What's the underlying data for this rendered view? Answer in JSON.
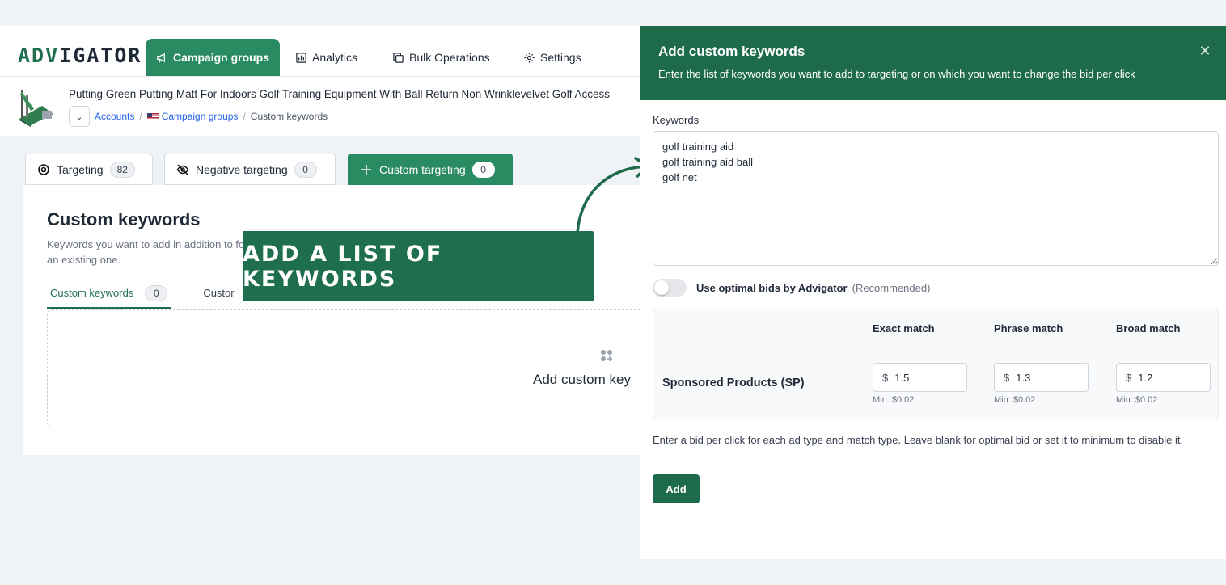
{
  "app": {
    "logo_prefix": "ADV",
    "logo_suffix": "IGATOR"
  },
  "nav": {
    "campaign_groups": "Campaign groups",
    "analytics": "Analytics",
    "bulk_operations": "Bulk Operations",
    "settings": "Settings"
  },
  "product": {
    "title": "Putting Green Putting Matt For Indoors Golf Training Equipment With Ball Return Non Wrinklevelvet Golf Access"
  },
  "breadcrumb": {
    "accounts": "Accounts",
    "campaign_groups": "Campaign groups",
    "current": "Custom keywords"
  },
  "tabs": [
    {
      "label": "Targeting",
      "count": "82",
      "icon": "target-icon"
    },
    {
      "label": "Negative targeting",
      "count": "0",
      "icon": "eye-off-icon"
    },
    {
      "label": "Custom targeting",
      "count": "0",
      "icon": "plus-icon"
    }
  ],
  "main": {
    "title": "Custom keywords",
    "description": "Keywords you want to add in addition to for an existing one.",
    "subtabs": [
      {
        "label": "Custom keywords",
        "count": "0"
      },
      {
        "label": "Custor"
      }
    ],
    "empty_text": "Add custom key"
  },
  "callout": {
    "text": "ADD A LIST OF KEYWORDS"
  },
  "panel": {
    "title": "Add custom keywords",
    "subtitle": "Enter the list of keywords you want to add to targeting or on which you want to change the bid per click",
    "keywords_label": "Keywords",
    "keywords_value": "golf training aid\ngolf training aid ball\ngolf net",
    "toggle_label": "Use optimal bids by Advigator",
    "toggle_hint": "(Recommended)",
    "toggle_on": false,
    "table": {
      "headers": [
        "Exact match",
        "Phrase match",
        "Broad match"
      ],
      "row_label": "Sponsored Products (SP)",
      "currency": "$",
      "values": [
        "1.5",
        "1.3",
        "1.2"
      ],
      "min_text": "Min: $0.02"
    },
    "help_text": "Enter a bid per click for each ad type and match type. Leave blank for optimal bid or set it to minimum to disable it.",
    "add_button": "Add"
  },
  "colors": {
    "brand_green": "#1e6b4b",
    "active_tab": "#2a8a62"
  }
}
